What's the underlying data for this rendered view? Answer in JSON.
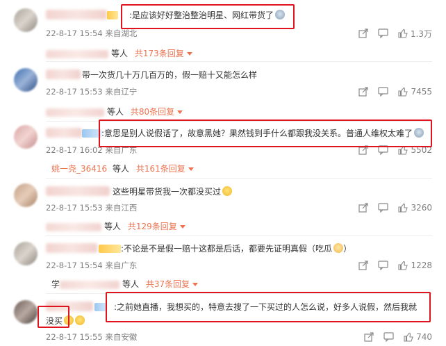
{
  "actions": {
    "share_label": "",
    "comment_label": ""
  },
  "comments": [
    {
      "text": "是应该好好整治整治明星、网红带货了",
      "time": "22-8-17 15:54 来自湖北",
      "likes": "1.3万",
      "reply_suffix": "等人",
      "reply_count": "共173条回复",
      "reply_name": "",
      "avatar_color": "gray",
      "emoji": "cry"
    },
    {
      "text": "带一次货几十万几百万的，假一赔十又能怎么样",
      "time": "22-8-17 15:53 来自辽宁",
      "likes": "7455",
      "reply_suffix": "等人",
      "reply_count": "共80条回复",
      "reply_name": "",
      "avatar_color": "blue"
    },
    {
      "text": "意思是别人说假话了，故意黑她？果然钱到手什么都跟我没关系。普通人维权太难了",
      "time": "22-8-17 16:02 来自广东",
      "likes": "5502",
      "reply_name": "姚一尧_36416",
      "reply_suffix": "等人",
      "reply_count": "共161条回复",
      "avatar_color": "pink",
      "emoji": "cry"
    },
    {
      "text": "这些明星带货我一次都没买过",
      "time": "22-8-17 15:53 来自江西",
      "likes": "3260",
      "reply_suffix": "等人",
      "reply_count": "共129条回复",
      "reply_name": "",
      "avatar_color": "tan",
      "emoji": "lol"
    },
    {
      "text": "不论是不是假一赔十这都是后话，都要先证明真假（吃瓜",
      "text_end": "）",
      "time": "22-8-17 15:54 来自广东",
      "likes": "1228",
      "reply_prefix": "学",
      "reply_suffix": "等人",
      "reply_count": "共37条回复",
      "reply_name": "",
      "avatar_color": "gray",
      "emoji": "cat"
    },
    {
      "text": "之前她直播，我想买的，特意去搜了一下买过的人怎么说，好多人说假，然后我就",
      "text_line2": "没买",
      "time": "22-8-17 15:55 来自安徽",
      "likes": "740",
      "avatar_color": "dark"
    }
  ],
  "colors": {
    "highlight_box": "#e0141e",
    "link": "#eb7350",
    "meta": "#808080"
  }
}
